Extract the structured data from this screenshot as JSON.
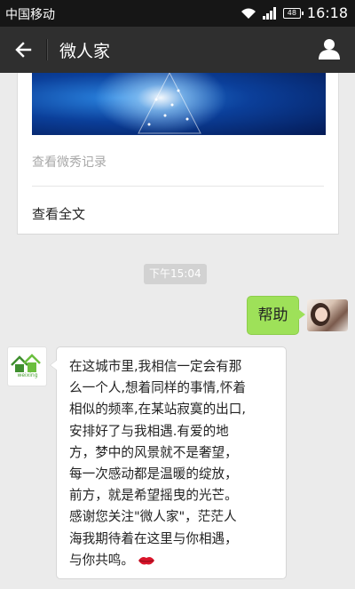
{
  "status_bar": {
    "carrier": "中国移动",
    "battery": "48",
    "time": "16:18"
  },
  "header": {
    "title": "微人家"
  },
  "article": {
    "more_link": "查看微秀记录",
    "read_all": "查看全文"
  },
  "chat": {
    "timestamp": "下午15:04",
    "outgoing": {
      "text": "帮助"
    },
    "incoming": {
      "avatar_label": "weixing",
      "lines": [
        "在这城市里,我相信一定会有那",
        "么一个人,想着同样的事情,怀着",
        "相似的频率,在某站寂寞的出口,",
        "安排好了与我相遇.有爱的地",
        "方，梦中的风景就不是奢望，",
        "每一次感动都是温暖的绽放，",
        "前方，就是希望摇曳的光芒。",
        "感谢您关注\"微人家\"，茫茫人",
        "海我期待着在这里与你相遇，",
        "与你共鸣。"
      ]
    }
  },
  "colors": {
    "status_bar": "#161616",
    "title_bar": "#2f2f2f",
    "background": "#ebebeb",
    "outgoing_bubble": "#9ee159",
    "lips": "#d9142a"
  },
  "icons": [
    "signal-icon",
    "wifi-icon",
    "back-arrow-icon",
    "person-icon",
    "house-logo-icon",
    "lips-emoji-icon"
  ]
}
